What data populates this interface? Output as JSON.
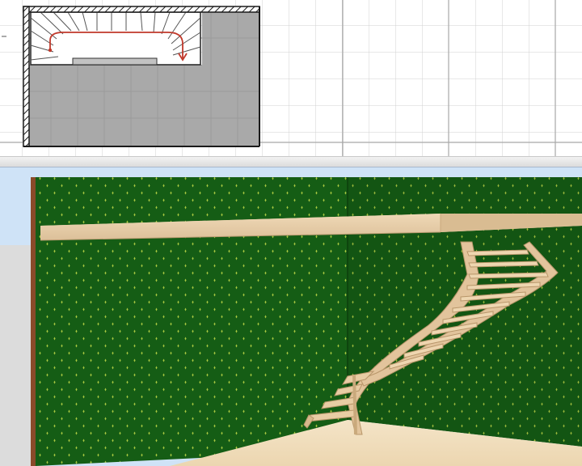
{
  "app": {
    "panes": [
      "plan-view",
      "splitter",
      "view-3d"
    ]
  },
  "colors": {
    "plan_background": "#ffffff",
    "plan_grid": "#d2d2d2",
    "plan_grid_major": "#a8a8a8",
    "room_floor": "#a9a9a9",
    "room_walls": "#1a1a1a",
    "stair_arrow": "#c0392b",
    "sky": "#cfe3f7",
    "wallpaper_base": "#155d15",
    "wallpaper_pattern": "#a7c840",
    "wood": "#e9cfa8",
    "wood_dark": "#c9a97c",
    "floor_wood": "#f1ddbb"
  },
  "icons": {
    "wall_hatch": "diagonal-hatch-icon",
    "stair_direction": "arrow-down-icon"
  }
}
